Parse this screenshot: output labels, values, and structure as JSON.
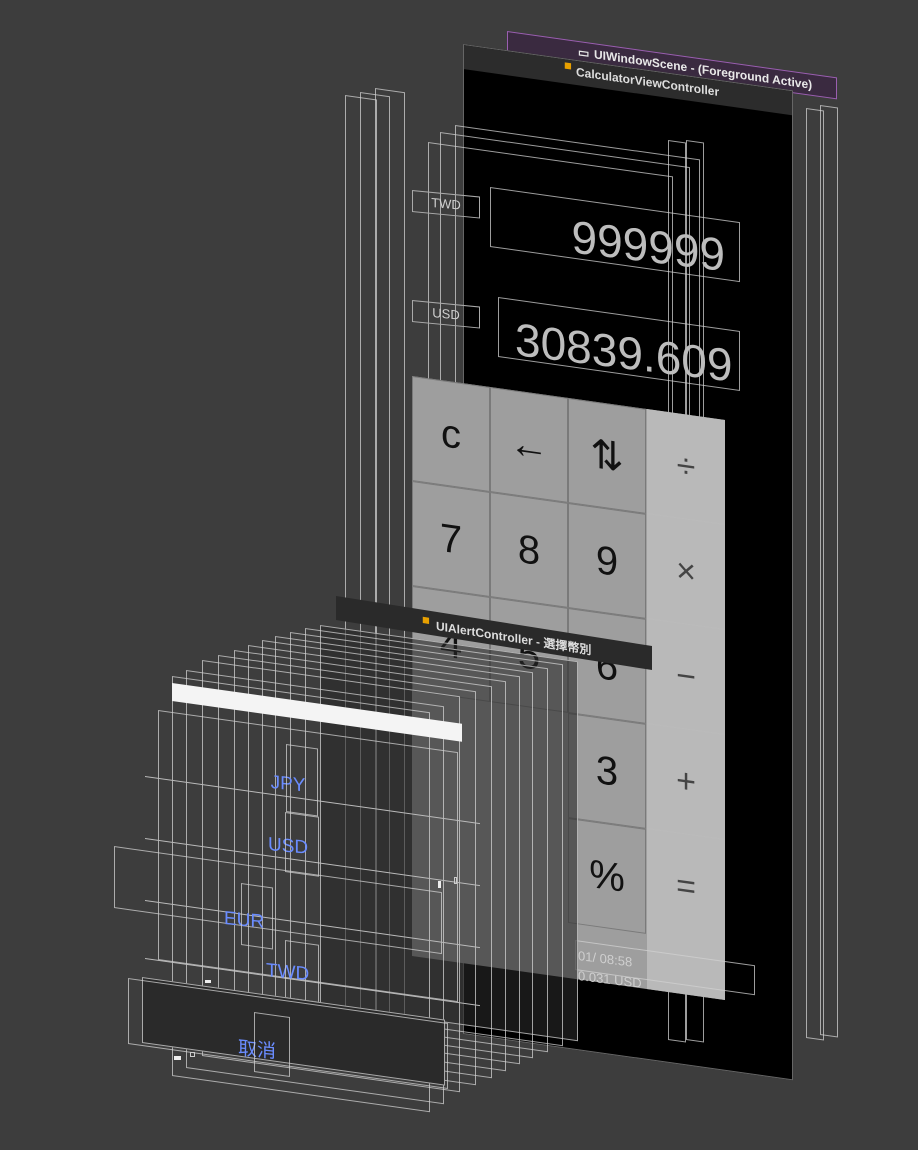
{
  "scene": {
    "title": "UIWindowScene - (Foreground Active)",
    "icon": "window-scene-icon"
  },
  "view_controller": {
    "title": "CalculatorViewController",
    "icon": "view-controller-icon"
  },
  "calculator": {
    "from_currency": "TWD",
    "from_value": "999999",
    "to_currency": "USD",
    "to_value": "30839.609",
    "keys": [
      [
        "c",
        "←",
        "⇅"
      ],
      [
        "7",
        "8",
        "9"
      ],
      [
        "4",
        "5",
        "6"
      ],
      [
        "",
        "",
        "3"
      ],
      [
        "",
        "",
        "%"
      ]
    ],
    "operators": [
      "÷",
      "×",
      "−",
      "+",
      "="
    ],
    "rate_time": "01/ 08:58",
    "rate_value": "0.031 USD"
  },
  "alert": {
    "title": "UIAlertController - 選擇幣別",
    "icon": "alert-controller-icon",
    "options": [
      "JPY",
      "USD",
      "EUR",
      "TWD"
    ],
    "cancel": "取消"
  }
}
